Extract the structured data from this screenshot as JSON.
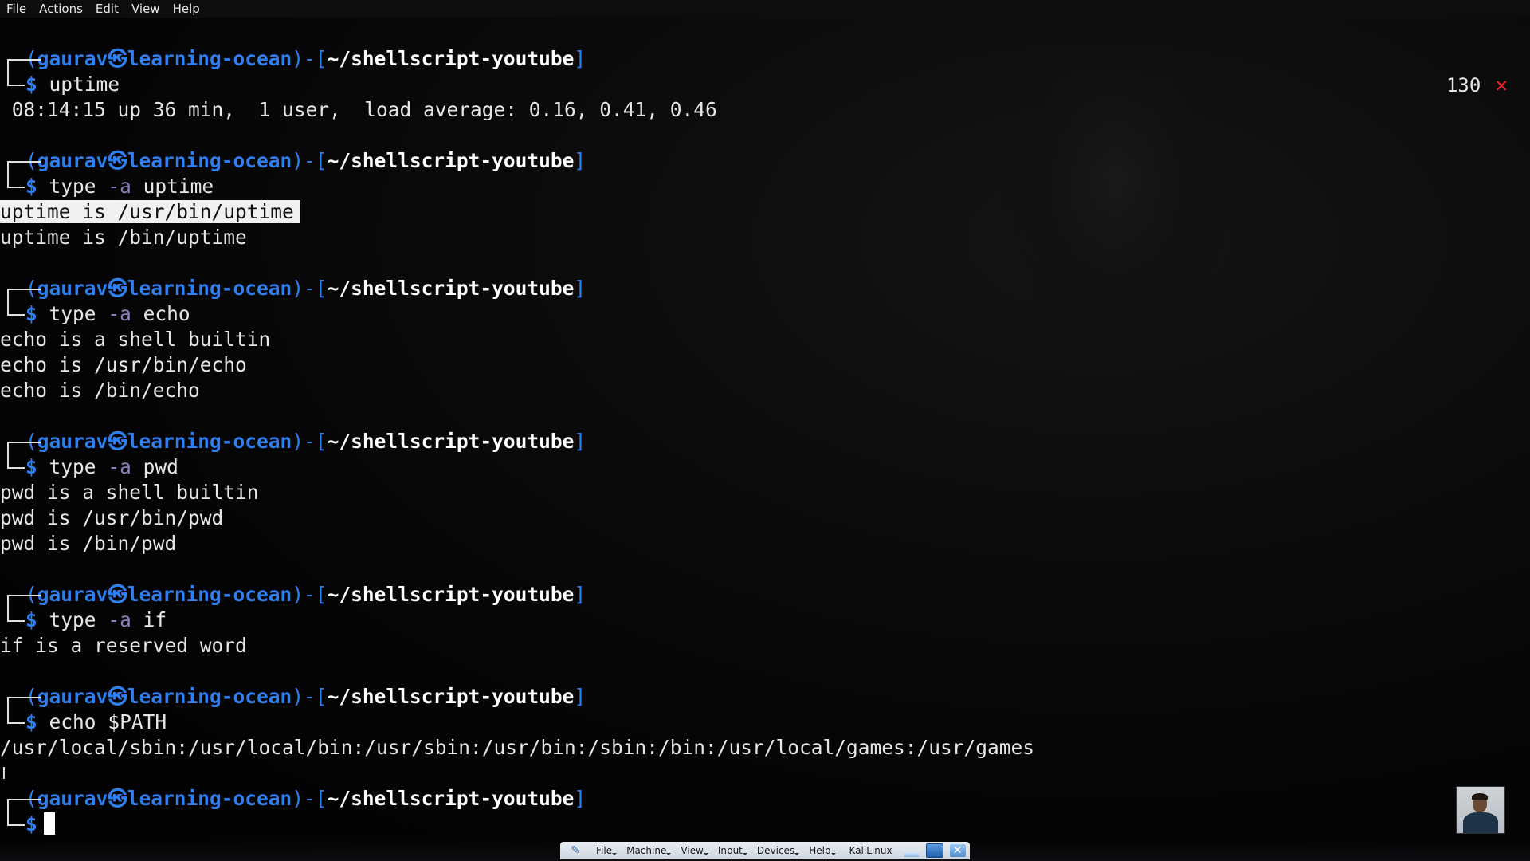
{
  "menubar": {
    "items": [
      "File",
      "Actions",
      "Edit",
      "View",
      "Help"
    ]
  },
  "status": {
    "exit_code": "130",
    "error_symbol": "✕"
  },
  "prompt": {
    "user": "gaurav",
    "host": "learning-ocean",
    "path": "~/shellscript-youtube",
    "symbol": "$"
  },
  "terminal": {
    "blocks": [
      {
        "cmd": "uptime",
        "cmd_opt": "",
        "cmd_arg": "",
        "output": [
          " 08:14:15 up 36 min,  1 user,  load average: 0.16, 0.41, 0.46"
        ]
      },
      {
        "cmd": "type",
        "cmd_opt": "-a",
        "cmd_arg": "uptime",
        "output": [
          "uptime is /usr/bin/uptime",
          "uptime is /bin/uptime"
        ]
      },
      {
        "cmd": "type",
        "cmd_opt": "-a",
        "cmd_arg": "echo",
        "output": [
          "echo is a shell builtin",
          "echo is /usr/bin/echo",
          "echo is /bin/echo"
        ]
      },
      {
        "cmd": "type",
        "cmd_opt": "-a",
        "cmd_arg": "pwd",
        "output": [
          "pwd is a shell builtin",
          "pwd is /usr/bin/pwd",
          "pwd is /bin/pwd"
        ]
      },
      {
        "cmd": "type",
        "cmd_opt": "-a",
        "cmd_arg": "if",
        "output": [
          "if is a reserved word"
        ]
      },
      {
        "cmd": "echo",
        "cmd_opt": "",
        "cmd_arg": "$PATH",
        "output": [
          "/usr/local/sbin:/usr/local/bin:/usr/sbin:/usr/bin:/sbin:/bin:/usr/local/games:/usr/games"
        ]
      }
    ]
  },
  "vbox": {
    "menus": [
      "File",
      "Machine",
      "View",
      "Input",
      "Devices",
      "Help"
    ],
    "vm_name": "KaliLinux"
  },
  "colors": {
    "prompt_blue": "#2f7ff0",
    "error_red": "#ee2222",
    "option_purple": "#8e7fb8"
  }
}
